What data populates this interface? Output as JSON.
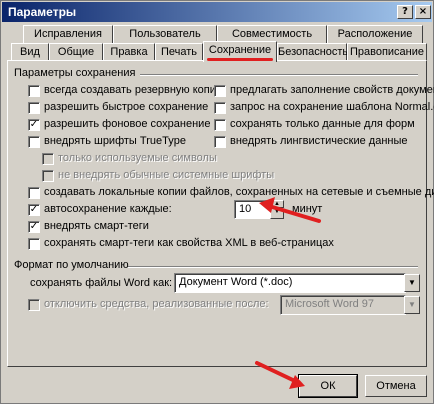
{
  "window": {
    "title": "Параметры"
  },
  "titlebar_buttons": {
    "help": "?",
    "close": "×"
  },
  "tabs_row1": [
    "Исправления",
    "Пользователь",
    "Совместимость",
    "Расположение"
  ],
  "tabs_row2": [
    "Вид",
    "Общие",
    "Правка",
    "Печать",
    "Сохранение",
    "Безопасность",
    "Правописание"
  ],
  "active_tab": "Сохранение",
  "save_group": {
    "label": "Параметры сохранения",
    "left": [
      {
        "label": "всегда создавать резервную копию",
        "checked": false
      },
      {
        "label": "разрешить быстрое сохранение",
        "checked": false
      },
      {
        "label": "разрешить фоновое сохранение",
        "checked": true
      },
      {
        "label": "внедрять шрифты TrueType",
        "checked": false
      }
    ],
    "right": [
      {
        "label": "предлагать заполнение свойств документа",
        "checked": false
      },
      {
        "label": "запрос на сохранение шаблона Normal.dot",
        "checked": false
      },
      {
        "label": "сохранять только данные для форм",
        "checked": false
      },
      {
        "label": "внедрять лингвистические данные",
        "checked": false
      }
    ],
    "sub": [
      {
        "label": "только используемые символы",
        "checked": false
      },
      {
        "label": "не внедрять обычные системные шрифты",
        "checked": false
      }
    ],
    "local_copy": "создавать локальные копии файлов, сохраненных на сетевые и съемные диски",
    "autosave": {
      "label": "автосохранение каждые:",
      "value": "10",
      "unit": "минут",
      "checked": true
    },
    "smart_tags": {
      "label": "внедрять смарт-теги",
      "checked": true
    },
    "smart_xml": {
      "label": "сохранять смарт-теги как свойства XML в веб-страницах",
      "checked": false
    }
  },
  "default_group": {
    "label": "Формат по умолчанию",
    "save_as_label": "сохранять файлы Word как:",
    "save_as_value": "Документ Word (*.doc)",
    "disable_label": "отключить средства, реализованные после:",
    "disable_value": "Microsoft Word 97"
  },
  "buttons": {
    "ok": "ОК",
    "cancel": "Отмена"
  },
  "annotation_color": "#e02020"
}
